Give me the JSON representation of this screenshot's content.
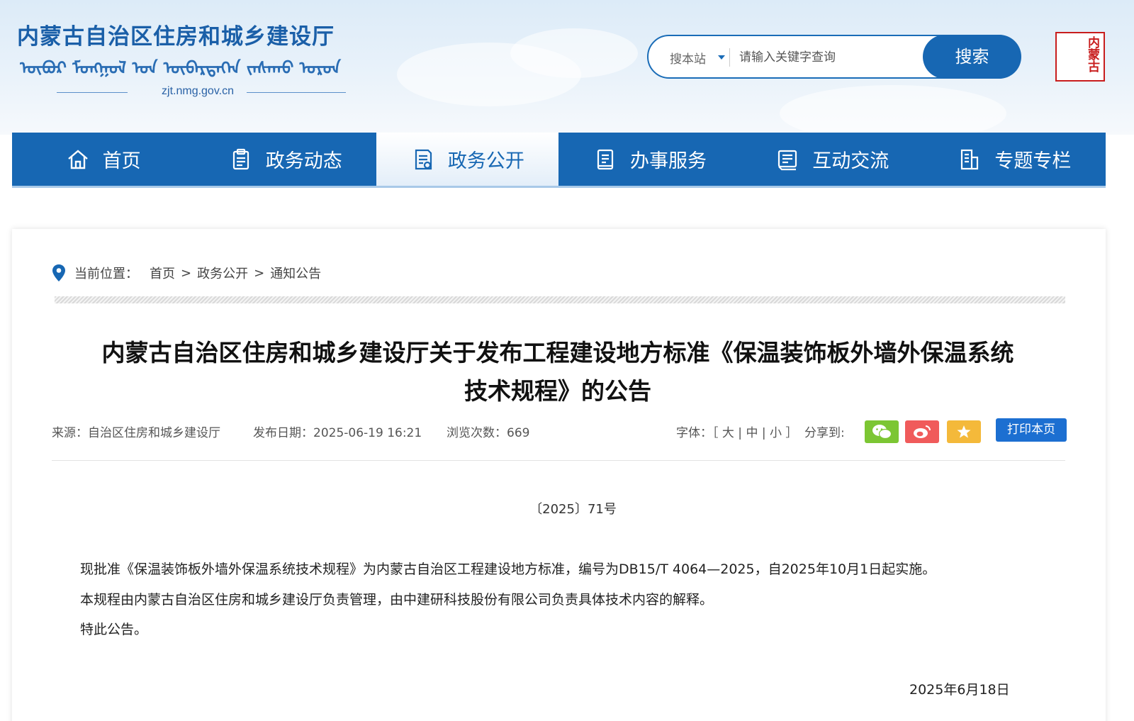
{
  "header": {
    "site_title": "内蒙古自治区住房和城乡建设厅",
    "mongolian_line": "ᠥᠪᠦᠷ ᠮᠣᠩᠭᠣᠯ ᠤᠨ ᠥᠪᠡᠷᠲᠡᠭᠡᠨ ᠵᠠᠰᠠᠬᠤ ᠣᠷᠣᠨ",
    "domain": "zjt.nmg.gov.cn",
    "seal_text": "内蒙古"
  },
  "search": {
    "scope": "搜本站",
    "placeholder": "请输入关键字查询",
    "button_label": "搜索"
  },
  "nav": {
    "items": [
      {
        "label": "首页",
        "icon": "home-icon"
      },
      {
        "label": "政务动态",
        "icon": "clipboard-icon"
      },
      {
        "label": "政务公开",
        "icon": "document-icon"
      },
      {
        "label": "办事服务",
        "icon": "service-icon"
      },
      {
        "label": "互动交流",
        "icon": "chat-book-icon"
      },
      {
        "label": "专题专栏",
        "icon": "column-icon"
      }
    ],
    "active_index": 2,
    "color": "#1767b3"
  },
  "breadcrumb": {
    "prefix": "当前位置：",
    "items": [
      "首页",
      ">",
      "政务公开",
      ">",
      "通知公告"
    ]
  },
  "article": {
    "title_line1": "内蒙古自治区住房和城乡建设厅关于发布工程建设地方标准《保温装饰板外墙外保温系统",
    "title_line2": "技术规程》的公告",
    "source": "来源：自治区住房和城乡建设厅",
    "publish_date": "发布日期：2025-06-19 16:21",
    "views": "浏览次数：669",
    "font_size_label": "字体：［ 大 | 中 | 小 ］",
    "share_label": "分享到:",
    "print_label": "打印本页",
    "doc_number": "〔2025〕71号",
    "paragraphs": [
      "现批准《保温装饰板外墙外保温系统技术规程》为内蒙古自治区工程建设地方标准，编号为DB15/T 4064—2025，自2025年10月1日起实施。",
      "本规程由内蒙古自治区住房和城乡建设厅负责管理，由中建研科技股份有限公司负责具体技术内容的解释。",
      "特此公告。"
    ],
    "sign_date": "2025年6月18日"
  },
  "colors": {
    "wechat": "#7cc633",
    "weibo": "#f05b5b",
    "favorite": "#f4b93a",
    "print": "#1c6fd1"
  }
}
